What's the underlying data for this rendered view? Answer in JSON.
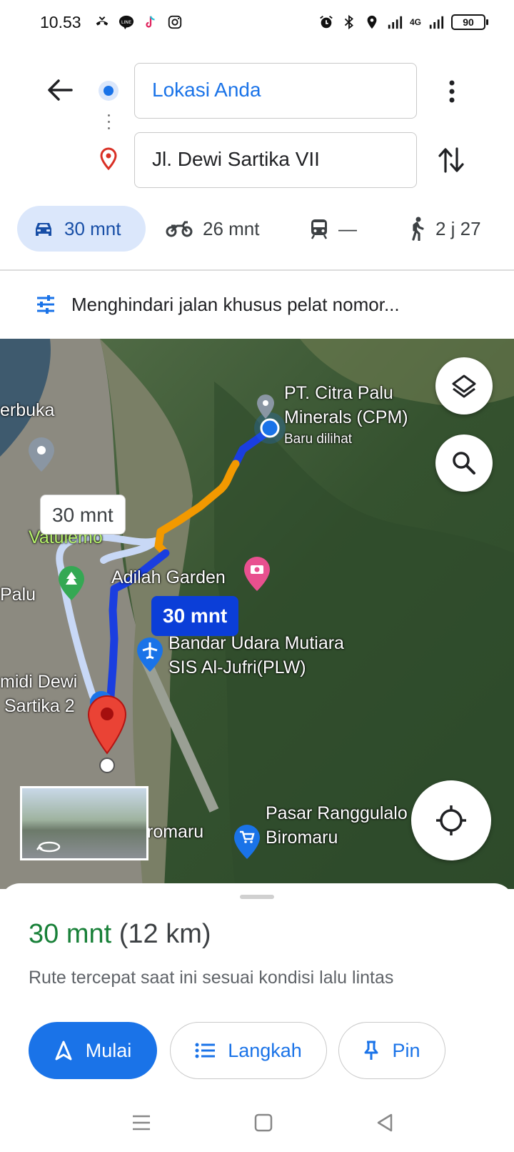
{
  "status_bar": {
    "time": "10.53",
    "battery": "90",
    "network": "4G"
  },
  "directions": {
    "origin": "Lokasi Anda",
    "destination": "Jl. Dewi Sartika VII"
  },
  "travel_modes": [
    {
      "mode": "car",
      "label": "30 mnt",
      "icon": "car-icon"
    },
    {
      "mode": "motorcycle",
      "label": "26 mnt",
      "icon": "motorcycle-icon"
    },
    {
      "mode": "transit",
      "label": "—",
      "icon": "train-icon"
    },
    {
      "mode": "walk",
      "label": "2 j 27",
      "icon": "walk-icon"
    }
  ],
  "route_options": "Menghindari jalan khusus pelat nomor...",
  "map": {
    "labels": {
      "terbuka": "erbuka",
      "cpm_line1": "PT. Citra Palu",
      "cpm_line2": "Minerals (CPM)",
      "recently_viewed": "Baru dilihat",
      "vatulemo": "Vatulemo",
      "adilah": "Adilah Garden",
      "palu": "Palu",
      "airport_line1": "Bandar Udara Mutiara",
      "airport_line2": "SIS Al-Jufri(PLW)",
      "indomaret_line1": "midi Dewi",
      "indomaret_line2": "Sartika 2",
      "biromaru": "romaru",
      "pasar_line1": "Pasar Ranggulalo",
      "pasar_line2": "Biromaru"
    },
    "alt_route_time": "30 mnt",
    "main_route_time": "30 mnt"
  },
  "summary": {
    "duration": "30 mnt",
    "distance": "(12 km)",
    "description": "Rute tercepat saat ini sesuai kondisi lalu lintas"
  },
  "actions": {
    "start": "Mulai",
    "steps": "Langkah",
    "pin": "Pin"
  },
  "colors": {
    "accent": "#1a73e8",
    "duration_green": "#188038",
    "route_blue": "#0b3ed8",
    "traffic_orange": "#f29900"
  }
}
